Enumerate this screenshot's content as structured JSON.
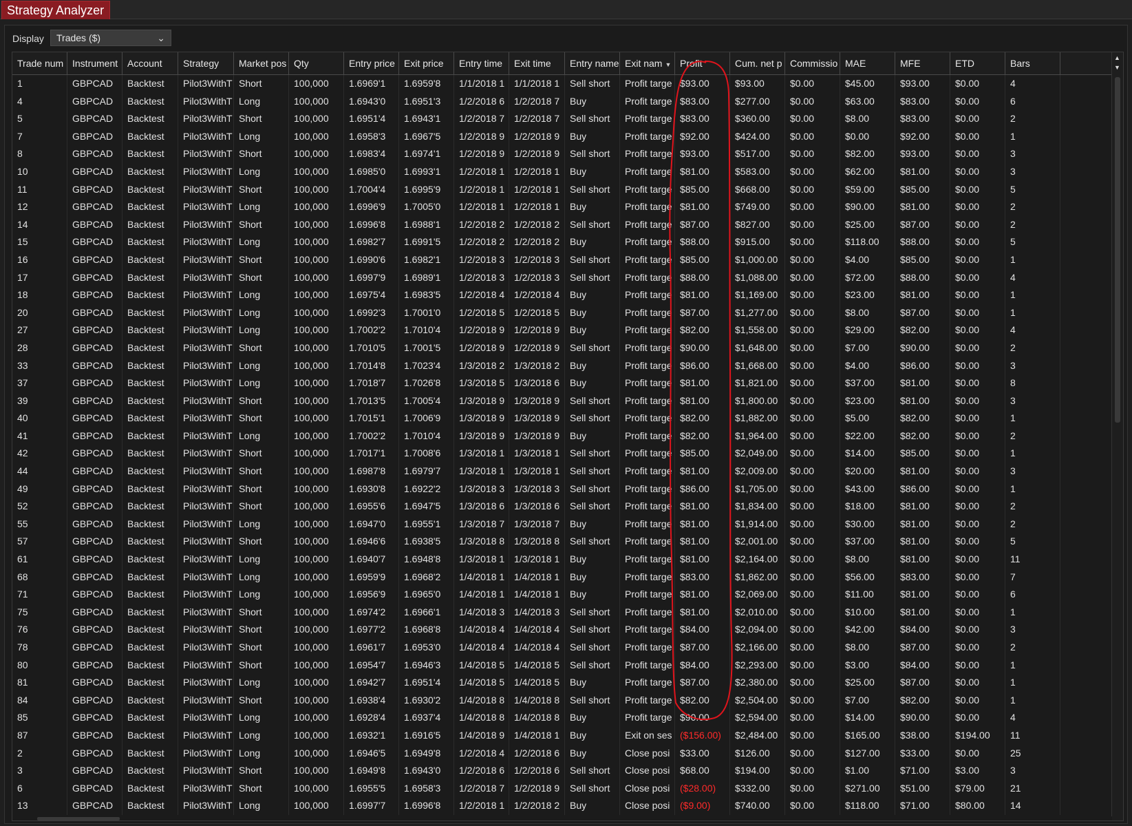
{
  "window": {
    "tab_title": "Strategy Analyzer"
  },
  "display": {
    "label": "Display",
    "value": "Trades ($)"
  },
  "colors": {
    "accent": "#8a1c22",
    "negative": "#ff2a2a",
    "annotation": "#e0141c"
  },
  "columns": [
    {
      "key": "trade",
      "label": "Trade num"
    },
    {
      "key": "instrument",
      "label": "Instrument"
    },
    {
      "key": "account",
      "label": "Account"
    },
    {
      "key": "strategy",
      "label": "Strategy"
    },
    {
      "key": "market_pos",
      "label": "Market pos"
    },
    {
      "key": "qty",
      "label": "Qty"
    },
    {
      "key": "entry_price",
      "label": "Entry price"
    },
    {
      "key": "exit_price",
      "label": "Exit price"
    },
    {
      "key": "entry_time",
      "label": "Entry time"
    },
    {
      "key": "exit_time",
      "label": "Exit time"
    },
    {
      "key": "entry_name",
      "label": "Entry name"
    },
    {
      "key": "exit_name",
      "label": "Exit nam"
    },
    {
      "key": "profit",
      "label": "Profit"
    },
    {
      "key": "cum_net",
      "label": "Cum. net p"
    },
    {
      "key": "commission",
      "label": "Commissio"
    },
    {
      "key": "mae",
      "label": "MAE"
    },
    {
      "key": "mfe",
      "label": "MFE"
    },
    {
      "key": "etd",
      "label": "ETD"
    },
    {
      "key": "bars",
      "label": "Bars"
    }
  ],
  "rows": [
    [
      "1",
      "GBPCAD",
      "Backtest",
      "Pilot3WithT",
      "Short",
      "100,000",
      "1.6969'1",
      "1.6959'8",
      "1/1/2018 1",
      "1/1/2018 1",
      "Sell short",
      "Profit targe",
      "$93.00",
      "$93.00",
      "$0.00",
      "$45.00",
      "$93.00",
      "$0.00",
      "4"
    ],
    [
      "4",
      "GBPCAD",
      "Backtest",
      "Pilot3WithT",
      "Long",
      "100,000",
      "1.6943'0",
      "1.6951'3",
      "1/2/2018 6",
      "1/2/2018 7",
      "Buy",
      "Profit targe",
      "$83.00",
      "$277.00",
      "$0.00",
      "$63.00",
      "$83.00",
      "$0.00",
      "6"
    ],
    [
      "5",
      "GBPCAD",
      "Backtest",
      "Pilot3WithT",
      "Short",
      "100,000",
      "1.6951'4",
      "1.6943'1",
      "1/2/2018 7",
      "1/2/2018 7",
      "Sell short",
      "Profit targe",
      "$83.00",
      "$360.00",
      "$0.00",
      "$8.00",
      "$83.00",
      "$0.00",
      "2"
    ],
    [
      "7",
      "GBPCAD",
      "Backtest",
      "Pilot3WithT",
      "Long",
      "100,000",
      "1.6958'3",
      "1.6967'5",
      "1/2/2018 9",
      "1/2/2018 9",
      "Buy",
      "Profit targe",
      "$92.00",
      "$424.00",
      "$0.00",
      "$0.00",
      "$92.00",
      "$0.00",
      "1"
    ],
    [
      "8",
      "GBPCAD",
      "Backtest",
      "Pilot3WithT",
      "Short",
      "100,000",
      "1.6983'4",
      "1.6974'1",
      "1/2/2018 9",
      "1/2/2018 9",
      "Sell short",
      "Profit targe",
      "$93.00",
      "$517.00",
      "$0.00",
      "$82.00",
      "$93.00",
      "$0.00",
      "3"
    ],
    [
      "10",
      "GBPCAD",
      "Backtest",
      "Pilot3WithT",
      "Long",
      "100,000",
      "1.6985'0",
      "1.6993'1",
      "1/2/2018 1",
      "1/2/2018 1",
      "Buy",
      "Profit targe",
      "$81.00",
      "$583.00",
      "$0.00",
      "$62.00",
      "$81.00",
      "$0.00",
      "3"
    ],
    [
      "11",
      "GBPCAD",
      "Backtest",
      "Pilot3WithT",
      "Short",
      "100,000",
      "1.7004'4",
      "1.6995'9",
      "1/2/2018 1",
      "1/2/2018 1",
      "Sell short",
      "Profit targe",
      "$85.00",
      "$668.00",
      "$0.00",
      "$59.00",
      "$85.00",
      "$0.00",
      "5"
    ],
    [
      "12",
      "GBPCAD",
      "Backtest",
      "Pilot3WithT",
      "Long",
      "100,000",
      "1.6996'9",
      "1.7005'0",
      "1/2/2018 1",
      "1/2/2018 1",
      "Buy",
      "Profit targe",
      "$81.00",
      "$749.00",
      "$0.00",
      "$90.00",
      "$81.00",
      "$0.00",
      "2"
    ],
    [
      "14",
      "GBPCAD",
      "Backtest",
      "Pilot3WithT",
      "Short",
      "100,000",
      "1.6996'8",
      "1.6988'1",
      "1/2/2018 2",
      "1/2/2018 2",
      "Sell short",
      "Profit targe",
      "$87.00",
      "$827.00",
      "$0.00",
      "$25.00",
      "$87.00",
      "$0.00",
      "2"
    ],
    [
      "15",
      "GBPCAD",
      "Backtest",
      "Pilot3WithT",
      "Long",
      "100,000",
      "1.6982'7",
      "1.6991'5",
      "1/2/2018 2",
      "1/2/2018 2",
      "Buy",
      "Profit targe",
      "$88.00",
      "$915.00",
      "$0.00",
      "$118.00",
      "$88.00",
      "$0.00",
      "5"
    ],
    [
      "16",
      "GBPCAD",
      "Backtest",
      "Pilot3WithT",
      "Short",
      "100,000",
      "1.6990'6",
      "1.6982'1",
      "1/2/2018 3",
      "1/2/2018 3",
      "Sell short",
      "Profit targe",
      "$85.00",
      "$1,000.00",
      "$0.00",
      "$4.00",
      "$85.00",
      "$0.00",
      "1"
    ],
    [
      "17",
      "GBPCAD",
      "Backtest",
      "Pilot3WithT",
      "Short",
      "100,000",
      "1.6997'9",
      "1.6989'1",
      "1/2/2018 3",
      "1/2/2018 3",
      "Sell short",
      "Profit targe",
      "$88.00",
      "$1,088.00",
      "$0.00",
      "$72.00",
      "$88.00",
      "$0.00",
      "4"
    ],
    [
      "18",
      "GBPCAD",
      "Backtest",
      "Pilot3WithT",
      "Long",
      "100,000",
      "1.6975'4",
      "1.6983'5",
      "1/2/2018 4",
      "1/2/2018 4",
      "Buy",
      "Profit targe",
      "$81.00",
      "$1,169.00",
      "$0.00",
      "$23.00",
      "$81.00",
      "$0.00",
      "1"
    ],
    [
      "20",
      "GBPCAD",
      "Backtest",
      "Pilot3WithT",
      "Long",
      "100,000",
      "1.6992'3",
      "1.7001'0",
      "1/2/2018 5",
      "1/2/2018 5",
      "Buy",
      "Profit targe",
      "$87.00",
      "$1,277.00",
      "$0.00",
      "$8.00",
      "$87.00",
      "$0.00",
      "1"
    ],
    [
      "27",
      "GBPCAD",
      "Backtest",
      "Pilot3WithT",
      "Long",
      "100,000",
      "1.7002'2",
      "1.7010'4",
      "1/2/2018 9",
      "1/2/2018 9",
      "Buy",
      "Profit targe",
      "$82.00",
      "$1,558.00",
      "$0.00",
      "$29.00",
      "$82.00",
      "$0.00",
      "4"
    ],
    [
      "28",
      "GBPCAD",
      "Backtest",
      "Pilot3WithT",
      "Short",
      "100,000",
      "1.7010'5",
      "1.7001'5",
      "1/2/2018 9",
      "1/2/2018 9",
      "Sell short",
      "Profit targe",
      "$90.00",
      "$1,648.00",
      "$0.00",
      "$7.00",
      "$90.00",
      "$0.00",
      "2"
    ],
    [
      "33",
      "GBPCAD",
      "Backtest",
      "Pilot3WithT",
      "Long",
      "100,000",
      "1.7014'8",
      "1.7023'4",
      "1/3/2018 2",
      "1/3/2018 2",
      "Buy",
      "Profit targe",
      "$86.00",
      "$1,668.00",
      "$0.00",
      "$4.00",
      "$86.00",
      "$0.00",
      "3"
    ],
    [
      "37",
      "GBPCAD",
      "Backtest",
      "Pilot3WithT",
      "Long",
      "100,000",
      "1.7018'7",
      "1.7026'8",
      "1/3/2018 5",
      "1/3/2018 6",
      "Buy",
      "Profit targe",
      "$81.00",
      "$1,821.00",
      "$0.00",
      "$37.00",
      "$81.00",
      "$0.00",
      "8"
    ],
    [
      "39",
      "GBPCAD",
      "Backtest",
      "Pilot3WithT",
      "Short",
      "100,000",
      "1.7013'5",
      "1.7005'4",
      "1/3/2018 9",
      "1/3/2018 9",
      "Sell short",
      "Profit targe",
      "$81.00",
      "$1,800.00",
      "$0.00",
      "$23.00",
      "$81.00",
      "$0.00",
      "3"
    ],
    [
      "40",
      "GBPCAD",
      "Backtest",
      "Pilot3WithT",
      "Short",
      "100,000",
      "1.7015'1",
      "1.7006'9",
      "1/3/2018 9",
      "1/3/2018 9",
      "Sell short",
      "Profit targe",
      "$82.00",
      "$1,882.00",
      "$0.00",
      "$5.00",
      "$82.00",
      "$0.00",
      "1"
    ],
    [
      "41",
      "GBPCAD",
      "Backtest",
      "Pilot3WithT",
      "Long",
      "100,000",
      "1.7002'2",
      "1.7010'4",
      "1/3/2018 9",
      "1/3/2018 9",
      "Buy",
      "Profit targe",
      "$82.00",
      "$1,964.00",
      "$0.00",
      "$22.00",
      "$82.00",
      "$0.00",
      "2"
    ],
    [
      "42",
      "GBPCAD",
      "Backtest",
      "Pilot3WithT",
      "Short",
      "100,000",
      "1.7017'1",
      "1.7008'6",
      "1/3/2018 1",
      "1/3/2018 1",
      "Sell short",
      "Profit targe",
      "$85.00",
      "$2,049.00",
      "$0.00",
      "$14.00",
      "$85.00",
      "$0.00",
      "1"
    ],
    [
      "44",
      "GBPCAD",
      "Backtest",
      "Pilot3WithT",
      "Short",
      "100,000",
      "1.6987'8",
      "1.6979'7",
      "1/3/2018 1",
      "1/3/2018 1",
      "Sell short",
      "Profit targe",
      "$81.00",
      "$2,009.00",
      "$0.00",
      "$20.00",
      "$81.00",
      "$0.00",
      "3"
    ],
    [
      "49",
      "GBPCAD",
      "Backtest",
      "Pilot3WithT",
      "Short",
      "100,000",
      "1.6930'8",
      "1.6922'2",
      "1/3/2018 3",
      "1/3/2018 3",
      "Sell short",
      "Profit targe",
      "$86.00",
      "$1,705.00",
      "$0.00",
      "$43.00",
      "$86.00",
      "$0.00",
      "1"
    ],
    [
      "52",
      "GBPCAD",
      "Backtest",
      "Pilot3WithT",
      "Short",
      "100,000",
      "1.6955'6",
      "1.6947'5",
      "1/3/2018 6",
      "1/3/2018 6",
      "Sell short",
      "Profit targe",
      "$81.00",
      "$1,834.00",
      "$0.00",
      "$18.00",
      "$81.00",
      "$0.00",
      "2"
    ],
    [
      "55",
      "GBPCAD",
      "Backtest",
      "Pilot3WithT",
      "Long",
      "100,000",
      "1.6947'0",
      "1.6955'1",
      "1/3/2018 7",
      "1/3/2018 7",
      "Buy",
      "Profit targe",
      "$81.00",
      "$1,914.00",
      "$0.00",
      "$30.00",
      "$81.00",
      "$0.00",
      "2"
    ],
    [
      "57",
      "GBPCAD",
      "Backtest",
      "Pilot3WithT",
      "Short",
      "100,000",
      "1.6946'6",
      "1.6938'5",
      "1/3/2018 8",
      "1/3/2018 8",
      "Sell short",
      "Profit targe",
      "$81.00",
      "$2,001.00",
      "$0.00",
      "$37.00",
      "$81.00",
      "$0.00",
      "5"
    ],
    [
      "61",
      "GBPCAD",
      "Backtest",
      "Pilot3WithT",
      "Long",
      "100,000",
      "1.6940'7",
      "1.6948'8",
      "1/3/2018 1",
      "1/3/2018 1",
      "Buy",
      "Profit targe",
      "$81.00",
      "$2,164.00",
      "$0.00",
      "$8.00",
      "$81.00",
      "$0.00",
      "11"
    ],
    [
      "68",
      "GBPCAD",
      "Backtest",
      "Pilot3WithT",
      "Long",
      "100,000",
      "1.6959'9",
      "1.6968'2",
      "1/4/2018 1",
      "1/4/2018 1",
      "Buy",
      "Profit targe",
      "$83.00",
      "$1,862.00",
      "$0.00",
      "$56.00",
      "$83.00",
      "$0.00",
      "7"
    ],
    [
      "71",
      "GBPCAD",
      "Backtest",
      "Pilot3WithT",
      "Long",
      "100,000",
      "1.6956'9",
      "1.6965'0",
      "1/4/2018 1",
      "1/4/2018 1",
      "Buy",
      "Profit targe",
      "$81.00",
      "$2,069.00",
      "$0.00",
      "$11.00",
      "$81.00",
      "$0.00",
      "6"
    ],
    [
      "75",
      "GBPCAD",
      "Backtest",
      "Pilot3WithT",
      "Short",
      "100,000",
      "1.6974'2",
      "1.6966'1",
      "1/4/2018 3",
      "1/4/2018 3",
      "Sell short",
      "Profit targe",
      "$81.00",
      "$2,010.00",
      "$0.00",
      "$10.00",
      "$81.00",
      "$0.00",
      "1"
    ],
    [
      "76",
      "GBPCAD",
      "Backtest",
      "Pilot3WithT",
      "Short",
      "100,000",
      "1.6977'2",
      "1.6968'8",
      "1/4/2018 4",
      "1/4/2018 4",
      "Sell short",
      "Profit targe",
      "$84.00",
      "$2,094.00",
      "$0.00",
      "$42.00",
      "$84.00",
      "$0.00",
      "3"
    ],
    [
      "78",
      "GBPCAD",
      "Backtest",
      "Pilot3WithT",
      "Short",
      "100,000",
      "1.6961'7",
      "1.6953'0",
      "1/4/2018 4",
      "1/4/2018 4",
      "Sell short",
      "Profit targe",
      "$87.00",
      "$2,166.00",
      "$0.00",
      "$8.00",
      "$87.00",
      "$0.00",
      "2"
    ],
    [
      "80",
      "GBPCAD",
      "Backtest",
      "Pilot3WithT",
      "Short",
      "100,000",
      "1.6954'7",
      "1.6946'3",
      "1/4/2018 5",
      "1/4/2018 5",
      "Sell short",
      "Profit targe",
      "$84.00",
      "$2,293.00",
      "$0.00",
      "$3.00",
      "$84.00",
      "$0.00",
      "1"
    ],
    [
      "81",
      "GBPCAD",
      "Backtest",
      "Pilot3WithT",
      "Long",
      "100,000",
      "1.6942'7",
      "1.6951'4",
      "1/4/2018 5",
      "1/4/2018 5",
      "Buy",
      "Profit targe",
      "$87.00",
      "$2,380.00",
      "$0.00",
      "$25.00",
      "$87.00",
      "$0.00",
      "1"
    ],
    [
      "84",
      "GBPCAD",
      "Backtest",
      "Pilot3WithT",
      "Short",
      "100,000",
      "1.6938'4",
      "1.6930'2",
      "1/4/2018 8",
      "1/4/2018 8",
      "Sell short",
      "Profit targe",
      "$82.00",
      "$2,504.00",
      "$0.00",
      "$7.00",
      "$82.00",
      "$0.00",
      "1"
    ],
    [
      "85",
      "GBPCAD",
      "Backtest",
      "Pilot3WithT",
      "Long",
      "100,000",
      "1.6928'4",
      "1.6937'4",
      "1/4/2018 8",
      "1/4/2018 8",
      "Buy",
      "Profit targe",
      "$90.00",
      "$2,594.00",
      "$0.00",
      "$14.00",
      "$90.00",
      "$0.00",
      "4"
    ],
    [
      "87",
      "GBPCAD",
      "Backtest",
      "Pilot3WithT",
      "Long",
      "100,000",
      "1.6932'1",
      "1.6916'5",
      "1/4/2018 9",
      "1/4/2018 1",
      "Buy",
      "Exit on ses",
      "($156.00)",
      "$2,484.00",
      "$0.00",
      "$165.00",
      "$38.00",
      "$194.00",
      "11"
    ],
    [
      "2",
      "GBPCAD",
      "Backtest",
      "Pilot3WithT",
      "Long",
      "100,000",
      "1.6946'5",
      "1.6949'8",
      "1/2/2018 4",
      "1/2/2018 6",
      "Buy",
      "Close posi",
      "$33.00",
      "$126.00",
      "$0.00",
      "$127.00",
      "$33.00",
      "$0.00",
      "25"
    ],
    [
      "3",
      "GBPCAD",
      "Backtest",
      "Pilot3WithT",
      "Short",
      "100,000",
      "1.6949'8",
      "1.6943'0",
      "1/2/2018 6",
      "1/2/2018 6",
      "Sell short",
      "Close posi",
      "$68.00",
      "$194.00",
      "$0.00",
      "$1.00",
      "$71.00",
      "$3.00",
      "3"
    ],
    [
      "6",
      "GBPCAD",
      "Backtest",
      "Pilot3WithT",
      "Short",
      "100,000",
      "1.6955'5",
      "1.6958'3",
      "1/2/2018 7",
      "1/2/2018 9",
      "Sell short",
      "Close posi",
      "($28.00)",
      "$332.00",
      "$0.00",
      "$271.00",
      "$51.00",
      "$79.00",
      "21"
    ],
    [
      "13",
      "GBPCAD",
      "Backtest",
      "Pilot3WithT",
      "Long",
      "100,000",
      "1.6997'7",
      "1.6996'8",
      "1/2/2018 1",
      "1/2/2018 2",
      "Buy",
      "Close posi",
      "($9.00)",
      "$740.00",
      "$0.00",
      "$118.00",
      "$71.00",
      "$80.00",
      "14"
    ]
  ]
}
